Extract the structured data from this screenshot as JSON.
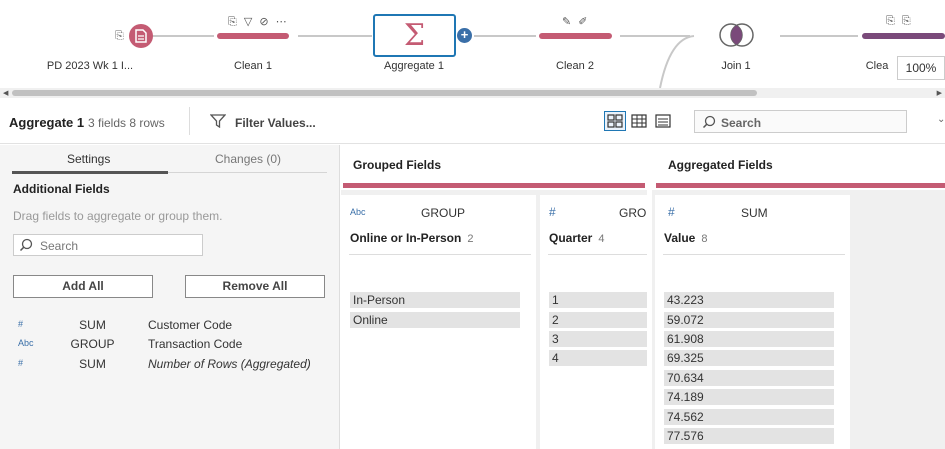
{
  "flow": {
    "nodes": [
      {
        "label": "PD 2023 Wk 1 I..."
      },
      {
        "label": "Clean 1"
      },
      {
        "label": "Aggregate 1"
      },
      {
        "label": "Clean 2"
      },
      {
        "label": "Join 1"
      },
      {
        "label": "Clea"
      }
    ],
    "zoom": "100%"
  },
  "header": {
    "title": "Aggregate 1",
    "meta": "3 fields  8 rows",
    "filter_label": "Filter Values...",
    "search_placeholder": "Search"
  },
  "settings": {
    "tabs": [
      {
        "label": "Settings",
        "active": true
      },
      {
        "label": "Changes (0)",
        "active": false
      }
    ],
    "section_title": "Additional Fields",
    "hint": "Drag fields to aggregate or group them.",
    "search_placeholder": "Search",
    "add_all": "Add All",
    "remove_all": "Remove All",
    "fields": [
      {
        "type_icon": "#",
        "aggregation": "SUM",
        "name": "Customer Code"
      },
      {
        "type_icon": "Abc",
        "aggregation": "GROUP",
        "name": "Transaction Code"
      },
      {
        "type_icon": "#",
        "aggregation": "SUM",
        "name": "Number of Rows (Aggregated)"
      }
    ]
  },
  "grouped": {
    "title": "Grouped Fields",
    "cards": [
      {
        "type_icon": "Abc",
        "aggregation": "GROUP",
        "name": "Online or In-Person",
        "count": "2",
        "values": [
          "In-Person",
          "Online"
        ]
      },
      {
        "type_icon": "#",
        "aggregation": "GROU",
        "name": "Quarter",
        "count": "4",
        "values": [
          "1",
          "2",
          "3",
          "4"
        ]
      }
    ]
  },
  "aggregated": {
    "title": "Aggregated Fields",
    "cards": [
      {
        "type_icon": "#",
        "aggregation": "SUM",
        "name": "Value",
        "count": "8",
        "values": [
          "43.223",
          "59.072",
          "61.908",
          "69.325",
          "70.634",
          "74.189",
          "74.562",
          "77.576"
        ]
      }
    ]
  },
  "colors": {
    "accent": "#c45b73",
    "selected_border": "#1f77b4",
    "join_bar": "#7a4a7a"
  }
}
